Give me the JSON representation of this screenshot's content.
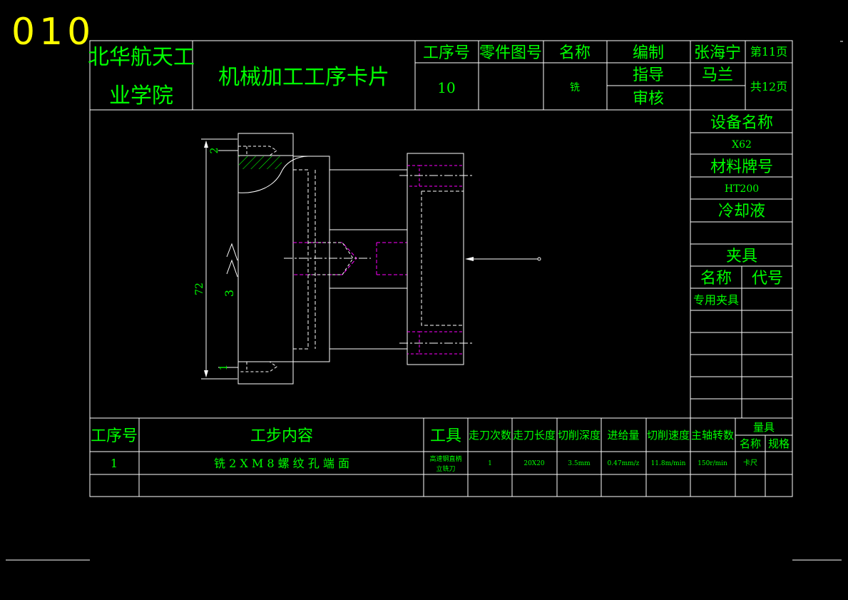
{
  "page_number": "010",
  "colors": {
    "background": "#000000",
    "lines": "#ffffff",
    "text": "#00ff00",
    "page_number": "#ffff00",
    "hidden": "#ff00ff"
  },
  "title_block": {
    "institution_line1": "北华航天工",
    "institution_line2": "业学院",
    "card_title": "机械加工工序卡片",
    "process_no_label": "工序号",
    "process_no": "10",
    "part_drawing_label": "零件图号",
    "part_drawing_no": "",
    "name_label": "名称",
    "name_value": "铣",
    "prepared_label": "编制",
    "prepared_by": "张海宁",
    "guided_label": "指导",
    "guided_by": "马兰",
    "reviewed_label": "审核",
    "reviewed_by": "",
    "sheet_label": "第11页",
    "total_label": "共12页"
  },
  "right_panel": {
    "equipment_label": "设备名称",
    "equipment": "X62",
    "material_label": "材料牌号",
    "material": "HT200",
    "coolant_label": "冷却液",
    "coolant": "",
    "fixture_label": "夹具",
    "fixture_name_label": "名称",
    "fixture_code_label": "代号",
    "fixture_name": "专用夹具",
    "fixture_code": ""
  },
  "drawing": {
    "dimension": "72",
    "callouts": [
      "1",
      "2",
      "3"
    ]
  },
  "step_table": {
    "headers": {
      "step_no": "工序号",
      "content": "工步内容",
      "tool": "工具",
      "passes": "走刀次数",
      "length": "走刀长度",
      "depth": "切削深度",
      "feed": "进给量",
      "speed": "切削速度",
      "rpm": "主轴转数",
      "gauge": "量具",
      "gauge_name": "名称",
      "gauge_spec": "规格"
    },
    "rows": [
      {
        "step_no": "1",
        "content": "铣 2 X M 8 螺 纹 孔 端 面",
        "tool_line1": "高速钢直柄",
        "tool_line2": "立铣刀",
        "passes": "1",
        "length": "20X20",
        "depth": "3.5mm",
        "feed": "0.47mm/z",
        "speed": "11.8m/min",
        "rpm": "150r/min",
        "gauge_name": "卡尺",
        "gauge_spec": ""
      }
    ]
  }
}
